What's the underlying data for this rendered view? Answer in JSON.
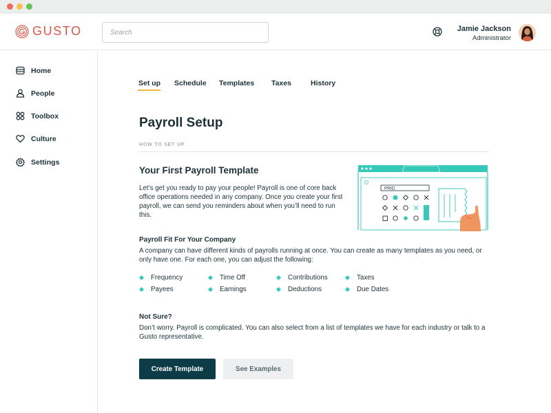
{
  "window": {
    "dot_colors": [
      "#ee6a5e",
      "#f5be4f",
      "#61c454"
    ]
  },
  "brand": {
    "name": "GUSTO",
    "color": "#e35546"
  },
  "search": {
    "placeholder": "Search",
    "value": ""
  },
  "user": {
    "name": "Jamie Jackson",
    "role": "Administrator"
  },
  "sidebar": {
    "items": [
      {
        "label": "Home",
        "icon": "home-icon"
      },
      {
        "label": "People",
        "icon": "person-icon"
      },
      {
        "label": "Toolbox",
        "icon": "grid-icon"
      },
      {
        "label": "Culture",
        "icon": "heart-icon"
      },
      {
        "label": "Settings",
        "icon": "gear-icon"
      }
    ]
  },
  "tabs": [
    {
      "label": "Set up",
      "active": true
    },
    {
      "label": "Schedule",
      "active": false
    },
    {
      "label": "Templates",
      "active": false
    },
    {
      "label": "Taxes",
      "active": false
    },
    {
      "label": "History",
      "active": false
    }
  ],
  "page": {
    "title": "Payroll Setup",
    "section_label": "HOW TO SET UP",
    "template_heading": "Your First Payroll Template",
    "template_text": "Let’s get you ready to pay your people! Payroll is one of core back office operations needed in any company. Once you create your first payroll, we can send you reminders about when you’ll need to run this.",
    "fit_heading": "Payroll Fit For Your Company",
    "fit_text": "A company can have different kinds of payrolls running at once. You can create as many templates as you need, or only have one. For each one, you can adjust the following:",
    "features": [
      "Frequency",
      "Payees",
      "Time Off",
      "Earnings",
      "Contributions",
      "Deductions",
      "Taxes",
      "Due Dates"
    ],
    "unsure_heading": "Not Sure?",
    "unsure_text": "Don’t worry. Payroll is complicated. You can also select from a list of templates we have for each industry or talk to a Gusto representative.",
    "illustration_field_text": "PRID"
  },
  "buttons": {
    "create": "Create Template",
    "examples": "See Examples"
  },
  "colors": {
    "accent_teal": "#35c9b9",
    "tab_underline": "#f4b73f",
    "primary_button": "#0d3c49",
    "text": "#1c3037"
  }
}
